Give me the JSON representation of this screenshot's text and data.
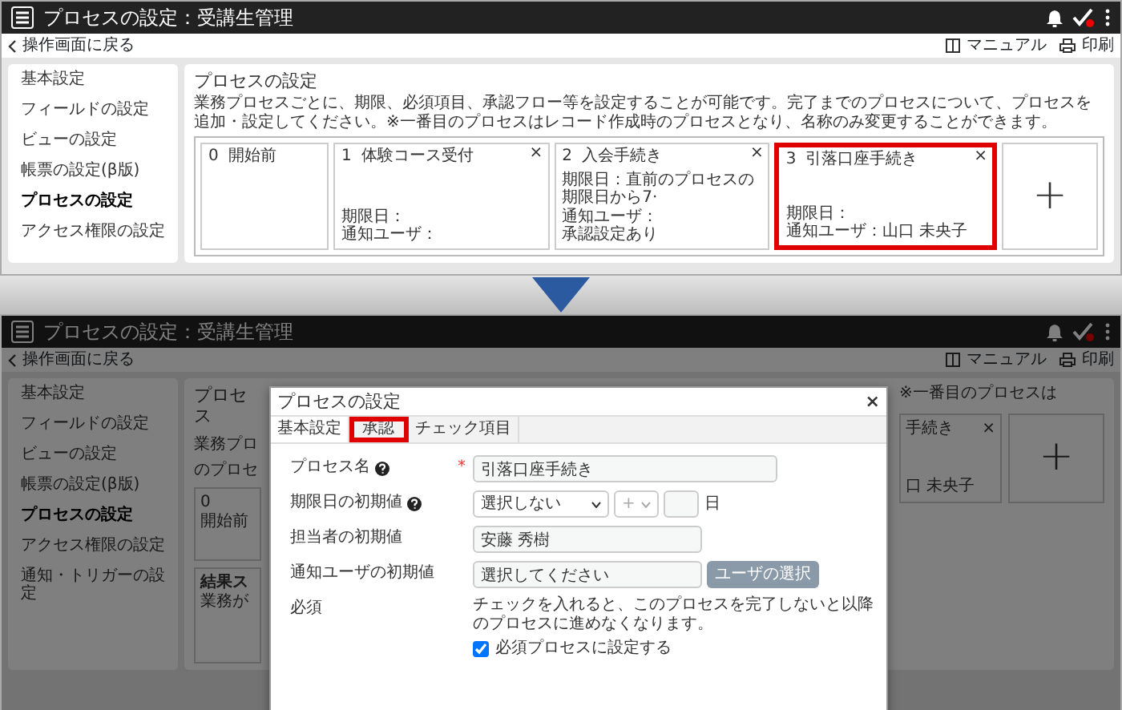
{
  "before_screen": {
    "header": {
      "title": "プロセスの設定：受講生管理"
    },
    "back_link": "操作画面に戻る",
    "toolbar_links": [
      {
        "kind": "manual",
        "label": "マニュアル"
      },
      {
        "kind": "print",
        "label": "印刷"
      }
    ],
    "sidebar": {
      "items": [
        {
          "label": "基本設定",
          "selected": false
        },
        {
          "label": "フィールドの設定",
          "selected": false
        },
        {
          "label": "ビューの設定",
          "selected": false
        },
        {
          "label": "帳票の設定(β版)",
          "selected": false
        },
        {
          "label": "プロセスの設定",
          "selected": true
        },
        {
          "label": "アクセス権限の設定",
          "selected": false
        }
      ]
    },
    "main": {
      "title": "プロセスの設定",
      "description": "業務プロセスごとに、期限、必須項目、承認フロー等を設定することが可能です。完了までのプロセスについて、プロセスを追加・設定してください。※一番目のプロセスはレコード作成時のプロセスとなり、名称のみ変更することができます。",
      "steps": [
        {
          "number": "0",
          "name": "開始前",
          "highlighted": false
        },
        {
          "number": "1",
          "name": "体験コース受付",
          "close": "×",
          "highlighted": false,
          "lines": [
            "期限日：",
            "通知ユーザ："
          ]
        },
        {
          "number": "2",
          "name": "入会手続き",
          "close": "×",
          "highlighted": false,
          "lines": [
            "期限日：直前のプロセスの期限日から7·",
            "通知ユーザ：",
            "承認設定あり"
          ]
        },
        {
          "number": "3",
          "name": "引落口座手続き",
          "close": "×",
          "highlighted": true,
          "lines": [
            "期限日：",
            "通知ユーザ：山口 未央子"
          ]
        }
      ],
      "add_button": "+"
    }
  },
  "after_screen": {
    "dimmed": true,
    "header": {
      "title": "プロセスの設定：受講生管理"
    },
    "back_link": "操作画面に戻る",
    "toolbar_links": [
      {
        "kind": "manual",
        "label": "マニュアル"
      },
      {
        "kind": "print",
        "label": "印刷"
      }
    ],
    "sidebar": {
      "items": [
        {
          "label": "基本設定",
          "selected": false
        },
        {
          "label": "フィールドの設定",
          "selected": false
        },
        {
          "label": "ビューの設定",
          "selected": false
        },
        {
          "label": "帳票の設定(β版)",
          "selected": false
        },
        {
          "label": "プロセスの設定",
          "selected": true
        },
        {
          "label": "アクセス権限の設定",
          "selected": false
        },
        {
          "label": "通知・トリガーの設定",
          "selected": false
        }
      ]
    },
    "background_left": [
      {
        "kind": "heading",
        "text": "プロセス"
      },
      {
        "kind": "text",
        "text": "業務プロ"
      },
      {
        "kind": "text",
        "text": "のプロセ"
      },
      {
        "kind": "step",
        "number": "0",
        "name": "開始前"
      },
      {
        "kind": "panel",
        "heading": "結果ス",
        "text": "業務が"
      }
    ],
    "background_right": {
      "text": "※一番目のプロセスは",
      "step_name": "手続き",
      "step_close": "×",
      "step_line": "口 未央子",
      "add_button": "+"
    },
    "modal": {
      "title": "プロセスの設定",
      "close": "×",
      "tabs": [
        {
          "label": "基本設定",
          "selected": true,
          "highlighted": false
        },
        {
          "label": "承認",
          "selected": false,
          "highlighted": true
        },
        {
          "label": "チェック項目",
          "selected": false,
          "highlighted": false
        }
      ],
      "fields": [
        {
          "kind": "text",
          "label": "プロセス名",
          "help": true,
          "required_mark": "*",
          "value": "引落口座手続き"
        },
        {
          "kind": "deadline",
          "label": "期限日の初期値",
          "help": true,
          "select_value": "選択しない",
          "sign": "+",
          "unit": "日"
        },
        {
          "kind": "text",
          "label": "担当者の初期値",
          "help": false,
          "value": "安藤 秀樹"
        },
        {
          "kind": "user",
          "label": "通知ユーザの初期値",
          "help": false,
          "value": "選択してください",
          "button": "ユーザの選択"
        },
        {
          "kind": "check",
          "label": "必須",
          "help": false,
          "note": "チェックを入れると、このプロセスを完了しないと以降のプロセスに進めなくなります。",
          "checkbox_label": "必須プロセスに設定する",
          "checked": true
        }
      ]
    }
  }
}
